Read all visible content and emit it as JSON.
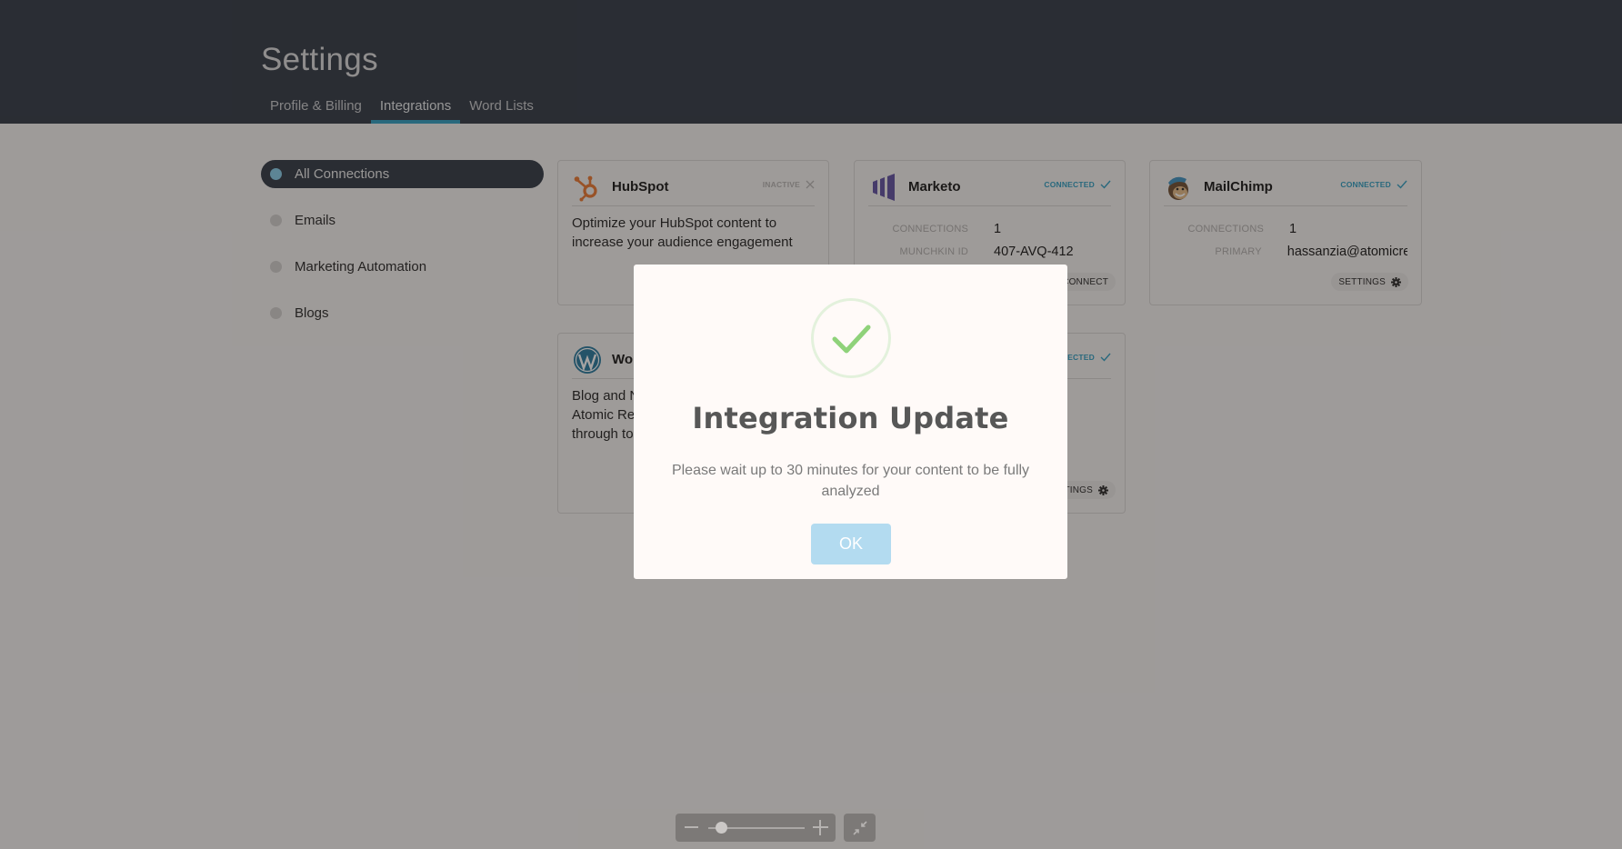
{
  "header": {
    "title": "Settings",
    "tabs": [
      {
        "label": "Profile & Billing",
        "active": false
      },
      {
        "label": "Integrations",
        "active": true
      },
      {
        "label": "Word Lists",
        "active": false
      }
    ]
  },
  "sidebar": {
    "items": [
      {
        "label": "All Connections",
        "active": true
      },
      {
        "label": "Emails",
        "active": false
      },
      {
        "label": "Marketing Automation",
        "active": false
      },
      {
        "label": "Blogs",
        "active": false
      }
    ]
  },
  "cards": {
    "hubspot": {
      "name": "HubSpot",
      "status": "INACTIVE",
      "description": "Optimize your HubSpot content to increase your audience engagement"
    },
    "marketo": {
      "name": "Marketo",
      "status": "CONNECTED",
      "connections_label": "CONNECTIONS",
      "connections_value": "1",
      "munchkin_label": "MUNCHKIN ID",
      "munchkin_value": "407-AVQ-412",
      "button_label": "CONNECT"
    },
    "mailchimp": {
      "name": "MailChimp",
      "status": "CONNECTED",
      "connections_label": "CONNECTIONS",
      "connections_value": "1",
      "primary_label": "PRIMARY",
      "primary_value": "hassanzia@atomicre",
      "button_label": "SETTINGS"
    },
    "wordpress": {
      "name": "Wor",
      "description_lines": [
        "Blog and N",
        "Atomic Rea",
        "through to"
      ]
    },
    "fifth": {
      "status": "NECTED",
      "button_label": "TINGS"
    }
  },
  "modal": {
    "title": "Integration Update",
    "message": "Please wait up to 30 minutes for your content to be fully analyzed",
    "ok_label": "OK"
  },
  "colors": {
    "header_bg": "#2b3441",
    "accent": "#2a9bc0",
    "success": "#8fd27a",
    "ok_button": "#b3dbf0"
  },
  "zoom_control": {
    "level_fraction": 0.14
  }
}
